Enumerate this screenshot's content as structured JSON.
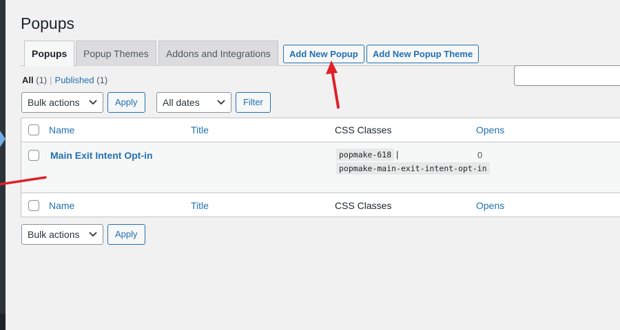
{
  "page": {
    "title": "Popups"
  },
  "tabs": [
    {
      "label": "Popups",
      "active": true
    },
    {
      "label": "Popup Themes"
    },
    {
      "label": "Addons and Integrations"
    }
  ],
  "tab_buttons": {
    "add_new_popup": "Add New Popup",
    "add_new_theme": "Add New Popup Theme"
  },
  "views": {
    "all": "All",
    "all_count": "(1)",
    "separator": "|",
    "published": "Published",
    "published_count": "(1)"
  },
  "bulk_top": {
    "bulk_actions": "Bulk actions",
    "apply": "Apply"
  },
  "date_filter": {
    "all_dates": "All dates",
    "filter": "Filter"
  },
  "table": {
    "columns": {
      "name": "Name",
      "title": "Title",
      "css_classes": "CSS Classes",
      "opens": "Opens"
    },
    "rows": [
      {
        "name": "Main Exit Intent Opt-in",
        "title": "",
        "css_class_1": "popmake-618",
        "css_sep": "|",
        "css_class_2": "popmake-main-exit-intent-opt-in",
        "opens": "0"
      }
    ]
  },
  "bulk_bottom": {
    "bulk_actions": "Bulk actions",
    "apply": "Apply"
  },
  "colors": {
    "accent": "#2271b1",
    "annotation": "#e0202a"
  }
}
